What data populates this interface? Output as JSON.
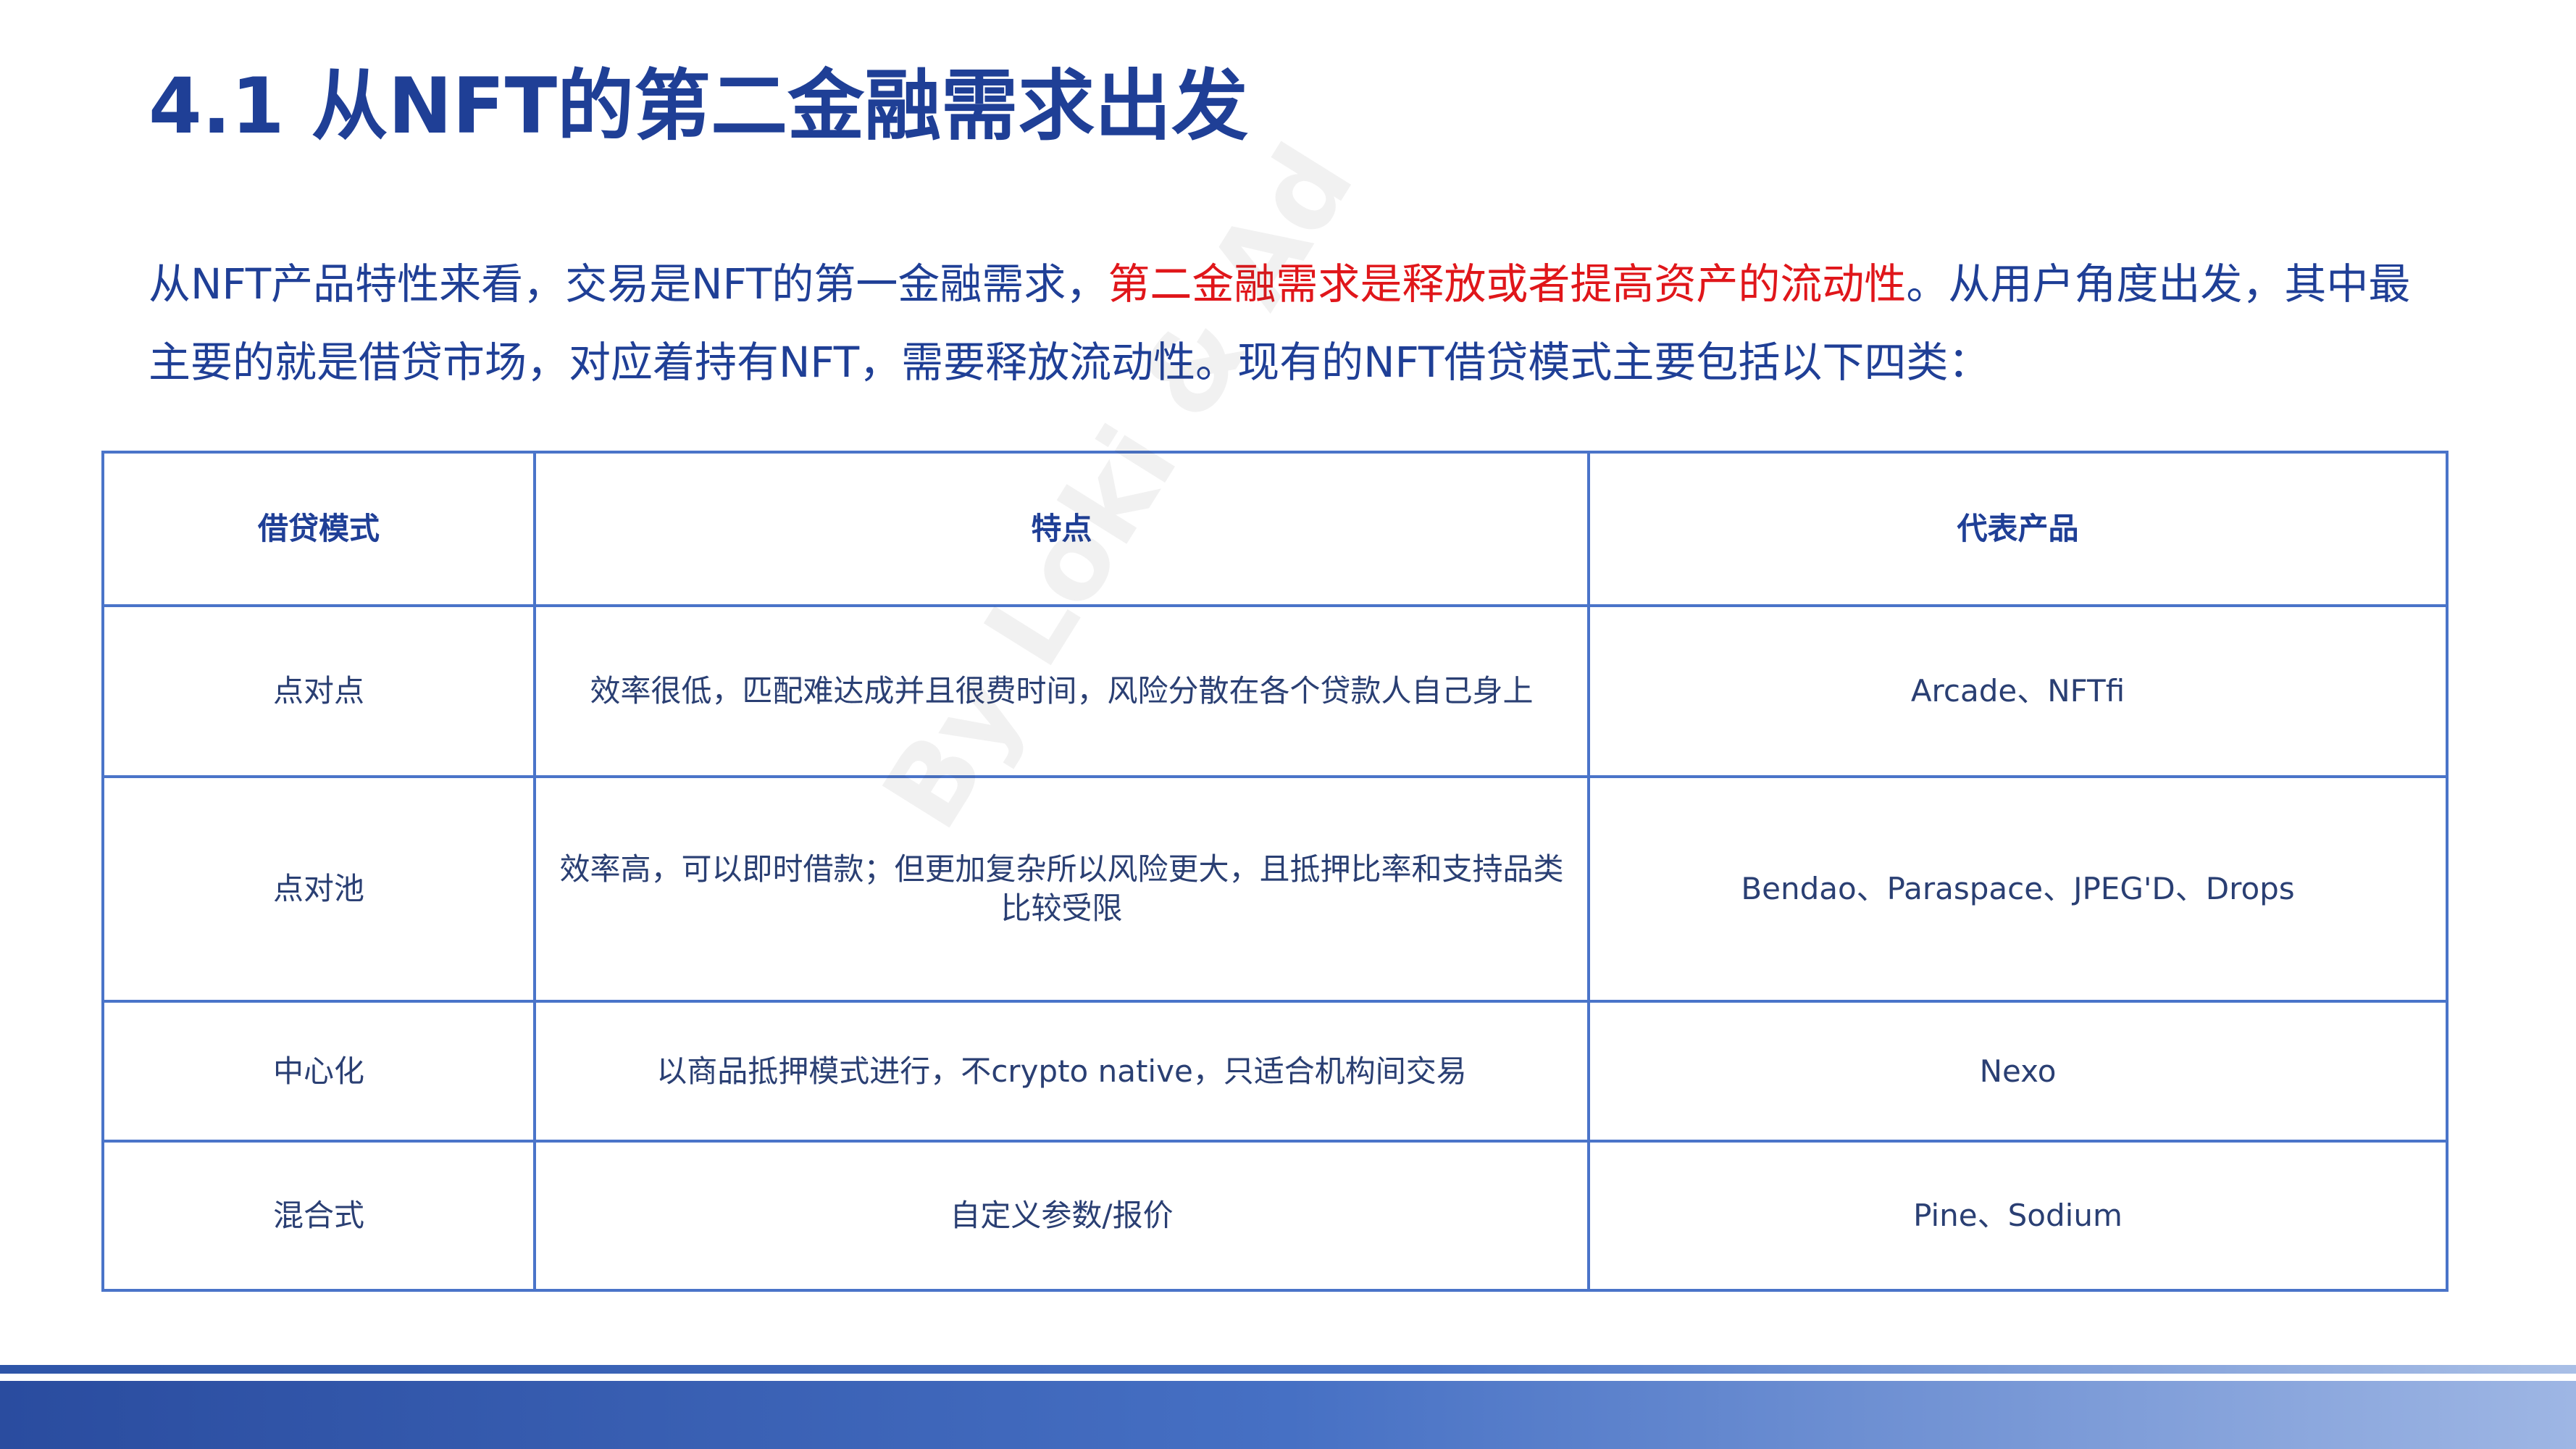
{
  "title": "4.1 从NFT的第二金融需求出发",
  "intro": {
    "part1": "从NFT产品特性来看，交易是NFT的第一金融需求，",
    "highlight": "第二金融需求是释放或者提高资产的流动性",
    "part2": "。从用户角度出发，其中最主要的就是借贷市场，对应着持有NFT，需要释放流动性。现有的NFT借贷模式主要包括以下四类："
  },
  "table": {
    "headers": [
      "借贷模式",
      "特点",
      "代表产品"
    ],
    "rows": [
      {
        "mode": "点对点",
        "feature": "效率很低，匹配难达成并且很费时间，风险分散在各个贷款人自己身上",
        "products": "Arcade、NFTfi"
      },
      {
        "mode": "点对池",
        "feature": "效率高，可以即时借款；但更加复杂所以风险更大，且抵押比率和支持品类比较受限",
        "products": "Bendao、Paraspace、JPEG'D、Drops"
      },
      {
        "mode": "中心化",
        "feature": "以商品抵押模式进行，不crypto native，只适合机构间交易",
        "products": "Nexo"
      },
      {
        "mode": "混合式",
        "feature": "自定义参数/报价",
        "products": "Pine、Sodium"
      }
    ]
  },
  "watermark": "By Loki & Ad",
  "colors": {
    "title": "#1f3f96",
    "highlight": "#e0161a",
    "table_border": "#4a74c9",
    "footer_band": "#2a4c9f"
  }
}
